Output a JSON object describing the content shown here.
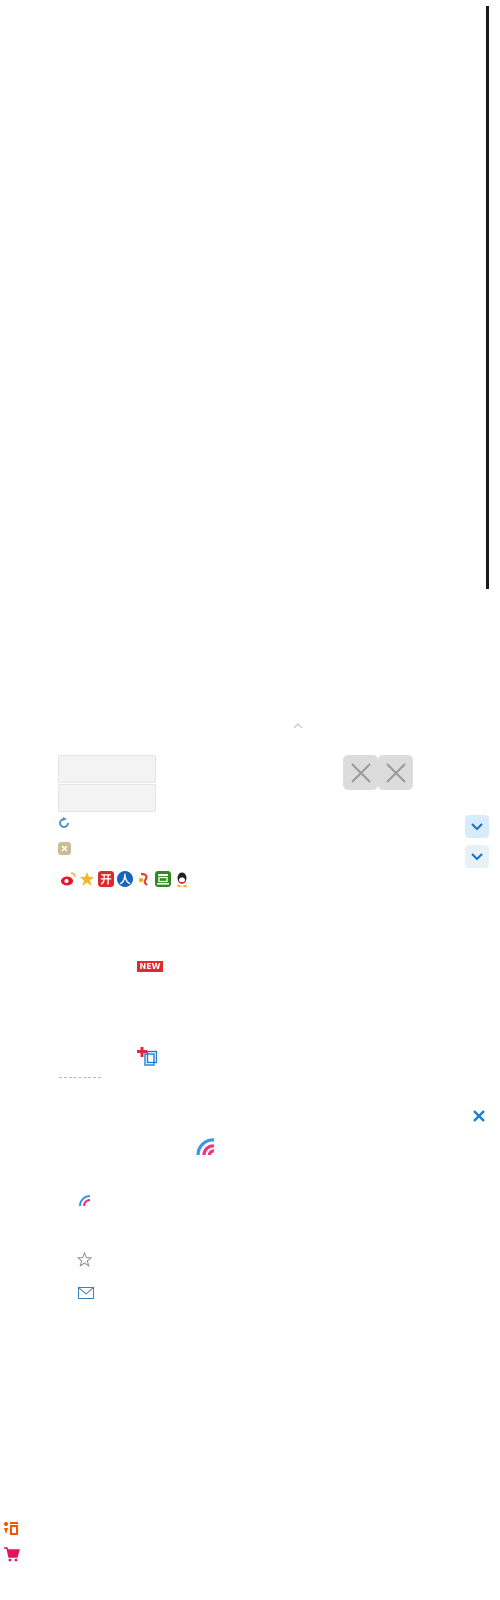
{
  "scrollbar": {
    "color": "#1a1a1a"
  },
  "icons": {
    "collapse": "chevron-up-icon",
    "remove_primary": "close-icon",
    "remove_secondary": "close-icon",
    "refresh": "refresh-icon",
    "clear": "clear-icon",
    "expand_primary": "chevron-down-icon",
    "expand_secondary": "chevron-down-icon",
    "add_copy": "add-copy-icon",
    "close": "close-icon",
    "rainbow_large": "rainbow-logo-icon",
    "rainbow_small": "rainbow-logo-icon",
    "favorite": "star-icon",
    "mail": "mail-icon",
    "taobao": "taobao-icon",
    "cart": "shopping-cart-icon"
  },
  "social_icons": [
    {
      "name": "weibo-icon",
      "glyph": "",
      "color": "#e6162d"
    },
    {
      "name": "qzone-icon",
      "glyph": "",
      "color": "#f5a623"
    },
    {
      "name": "kaixin-icon",
      "glyph": "开",
      "color": "#d92b2b"
    },
    {
      "name": "renren-icon",
      "glyph": "人",
      "color": "#1a62c0"
    },
    {
      "name": "sohu-icon",
      "glyph": "",
      "color": "#e63e2d"
    },
    {
      "name": "douban-icon",
      "glyph": "",
      "color": "#2e8b1f"
    },
    {
      "name": "qq-icon",
      "glyph": "",
      "color": "#222222"
    }
  ],
  "badge": {
    "new_label": "NEW"
  },
  "colors": {
    "accent_blue": "#1a7fd4",
    "badge_red": "#e02a32",
    "taobao_orange": "#ff5000",
    "cart_pink": "#e4135f"
  }
}
